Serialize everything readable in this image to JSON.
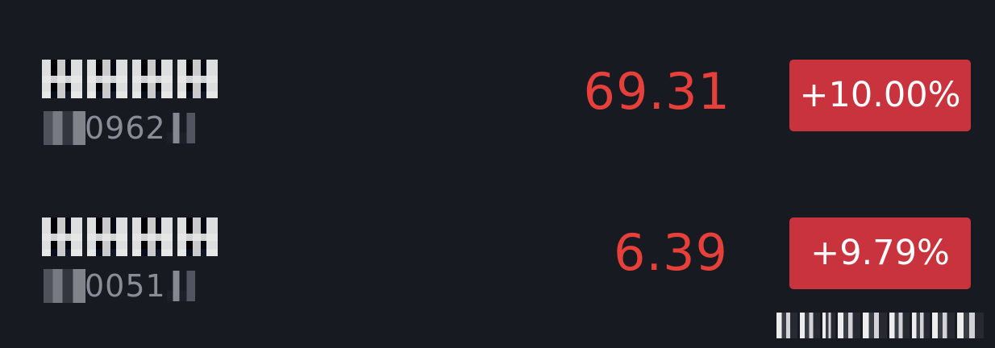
{
  "rows": [
    {
      "code_visible": "0962",
      "price": "69.31",
      "change": "+10.00%",
      "colors": {
        "price": "#e7403b",
        "badge": "#c9333d"
      }
    },
    {
      "code_visible": "0051",
      "price": "6.39",
      "change": "+9.79%",
      "colors": {
        "price": "#e7403b",
        "badge": "#c9333d"
      }
    }
  ]
}
